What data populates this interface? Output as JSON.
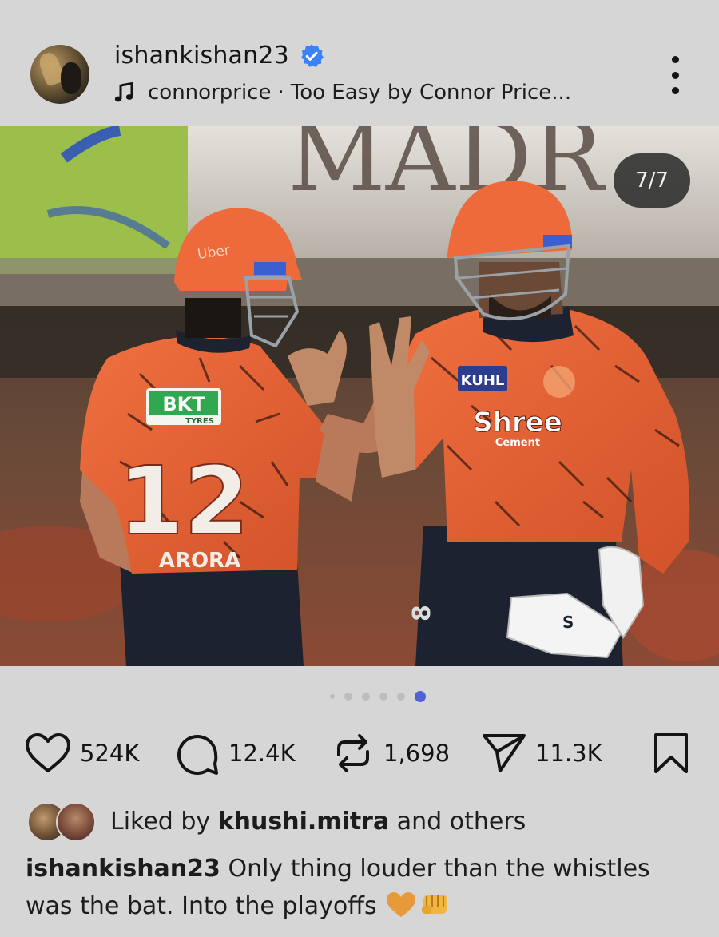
{
  "header": {
    "username": "ishankishan23",
    "verified": true,
    "audio_artist": "connorprice",
    "audio_separator": "·",
    "audio_title": "Too Easy by Connor Price...",
    "icons": [
      "avatar",
      "verified-badge-icon",
      "music-note-icon",
      "more-options-icon"
    ]
  },
  "media": {
    "counter": "7/7",
    "current_slide": 7,
    "total_slides": 7,
    "jersey_number": "12",
    "jersey_name": "ARORA",
    "sponsor_chest": "BKT",
    "sponsor_chest_sub": "TYRES",
    "sponsor_kuhl": "KUHL",
    "sponsor_shree": "Shree",
    "sponsor_shree_sub": "Cement",
    "helmet_brand": "Uber",
    "background_banner": "MADR",
    "muted": true
  },
  "carousel_dots": {
    "count": 6,
    "active_index": 5
  },
  "actions": {
    "likes": "524K",
    "comments": "12.4K",
    "reposts": "1,698",
    "shares": "11.3K",
    "icons": [
      "heart-icon",
      "comment-icon",
      "repost-icon",
      "share-icon",
      "bookmark-icon"
    ]
  },
  "liked_by": {
    "prefix": "Liked by",
    "user": "khushi.mitra",
    "suffix": "and others"
  },
  "caption": {
    "user": "ishankishan23",
    "text": "Only thing louder than the whistles was the bat. Into the playoffs",
    "emojis": [
      "orange-heart",
      "oncoming-fist"
    ]
  },
  "colors": {
    "background": "#d6d6d6",
    "verified_blue": "#3b82f6",
    "active_dot": "#4f63d6",
    "jersey_orange": "#e8622f"
  }
}
